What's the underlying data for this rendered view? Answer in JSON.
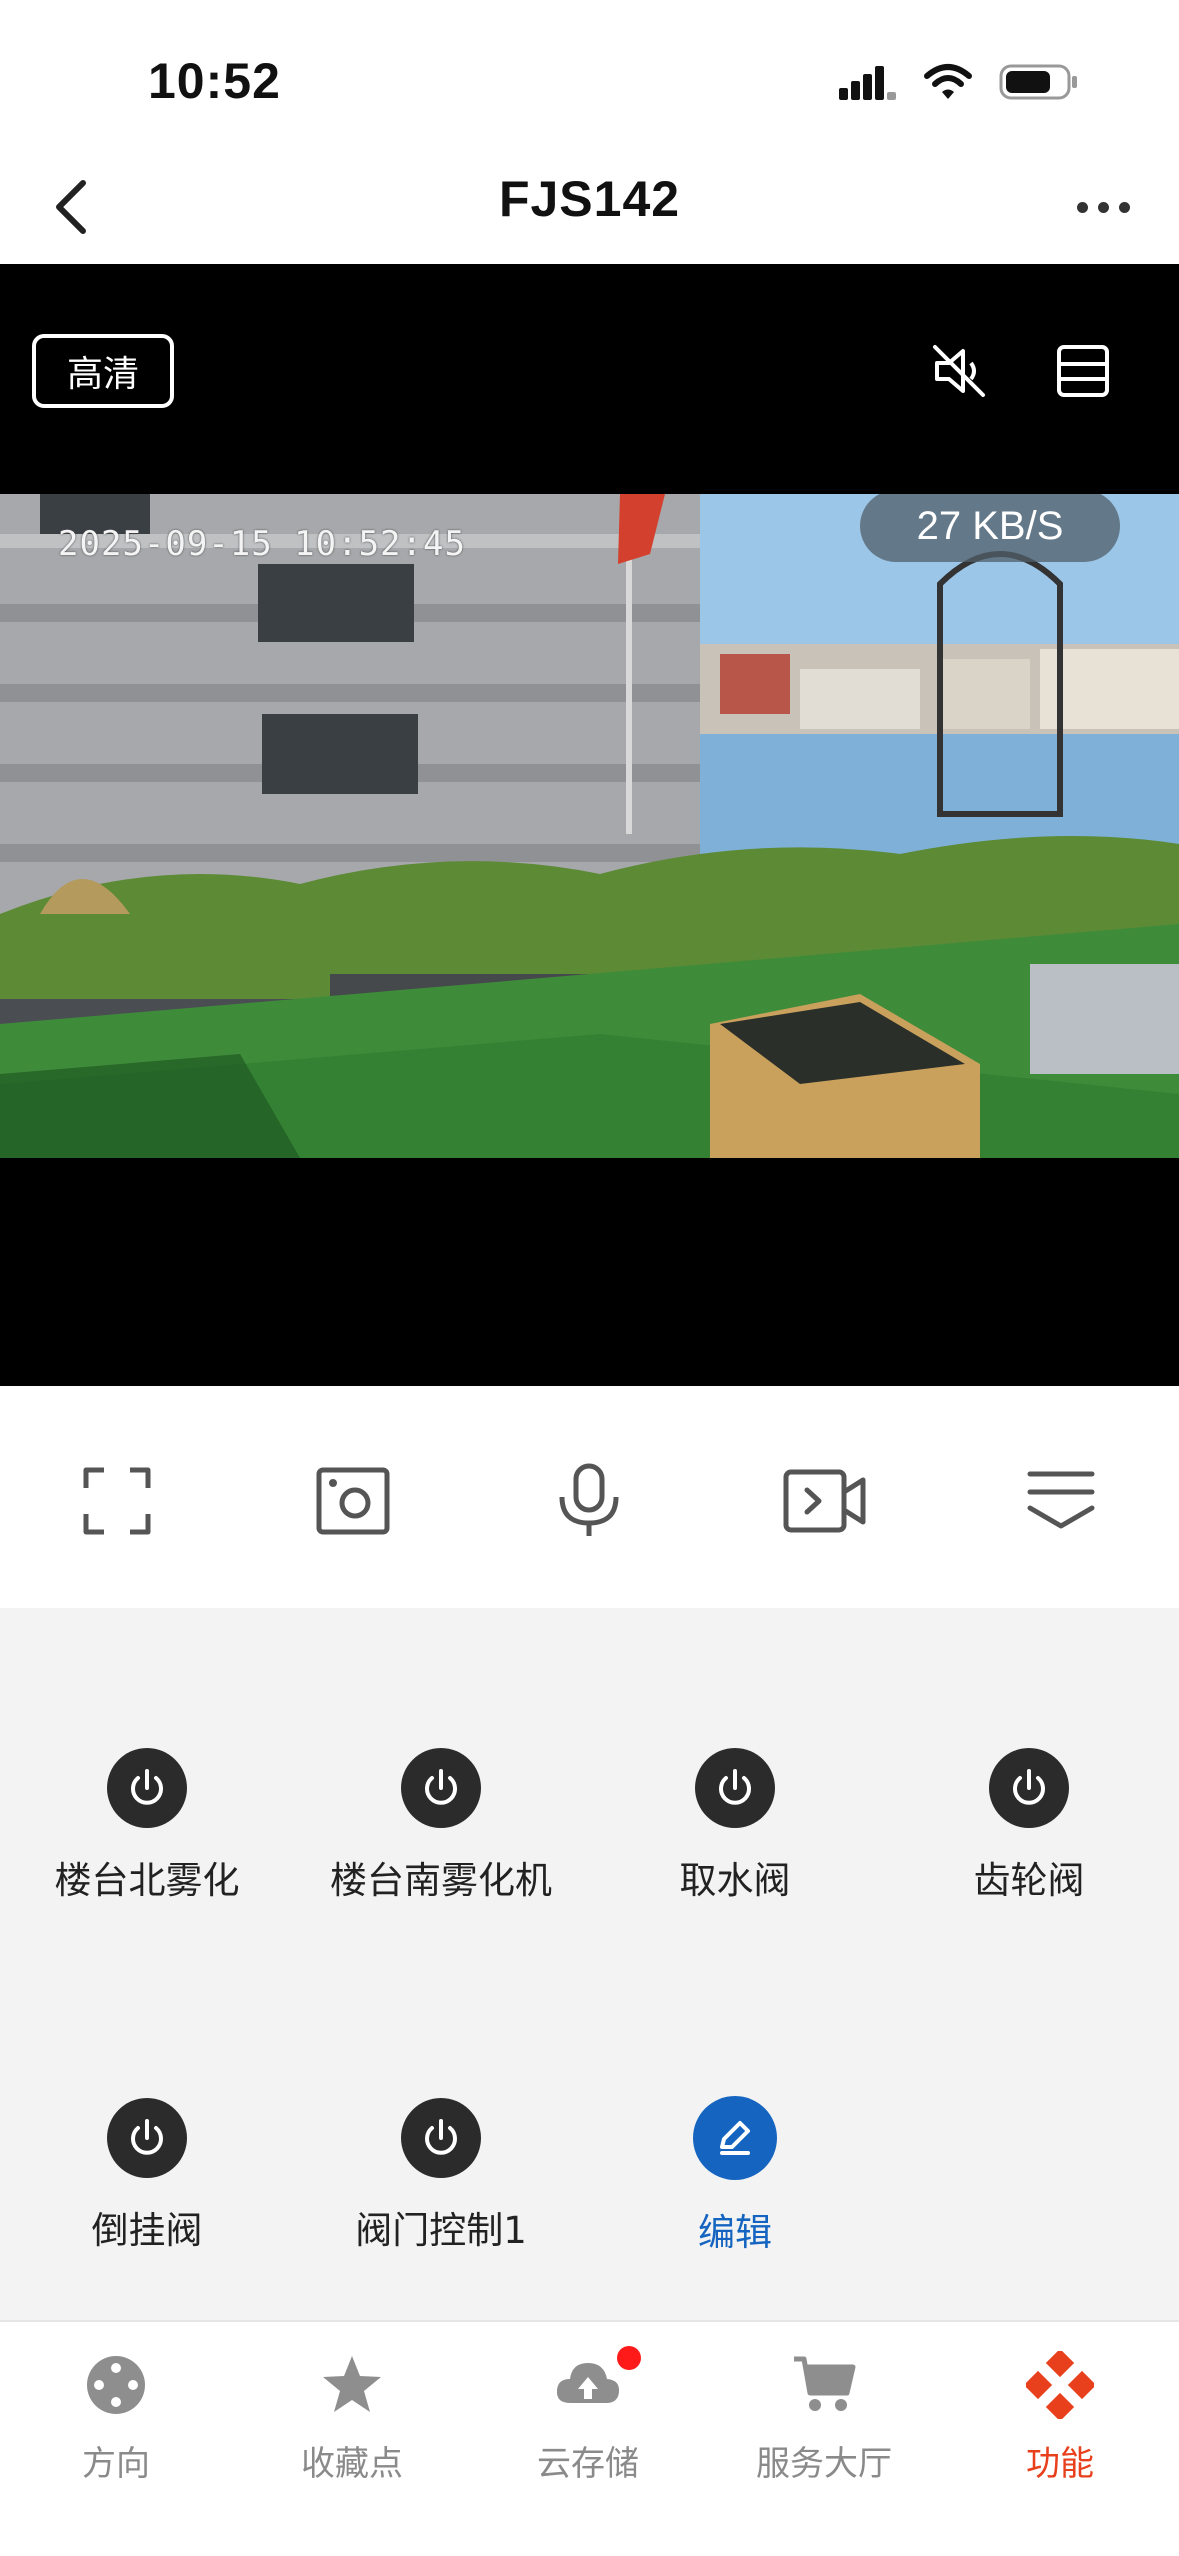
{
  "status_bar": {
    "time": "10:52"
  },
  "nav": {
    "title": "FJS142"
  },
  "video": {
    "quality_label": "高清",
    "timestamp": "2025-09-15 10:52:45",
    "speed": "27 KB/S"
  },
  "functions": [
    {
      "label": "楼台北雾化",
      "icon": "power-icon"
    },
    {
      "label": "楼台南雾化机",
      "icon": "power-icon"
    },
    {
      "label": "取水阀",
      "icon": "power-icon"
    },
    {
      "label": "齿轮阀",
      "icon": "power-icon"
    },
    {
      "label": "倒挂阀",
      "icon": "power-icon"
    },
    {
      "label": "阀门控制1",
      "icon": "power-icon"
    },
    {
      "label": "编辑",
      "icon": "edit-icon"
    }
  ],
  "tabs": [
    {
      "label": "方向",
      "icon": "direction-icon",
      "active": false
    },
    {
      "label": "收藏点",
      "icon": "star-icon",
      "active": false
    },
    {
      "label": "云存储",
      "icon": "cloud-upload-icon",
      "active": false,
      "badge": true
    },
    {
      "label": "服务大厅",
      "icon": "cart-icon",
      "active": false
    },
    {
      "label": "功能",
      "icon": "function-icon",
      "active": true
    }
  ],
  "colors": {
    "accent_blue": "#1565c0",
    "active_tab": "#e8401c",
    "badge_red": "#ff1a1a",
    "panel_bg": "#f3f3f3"
  }
}
